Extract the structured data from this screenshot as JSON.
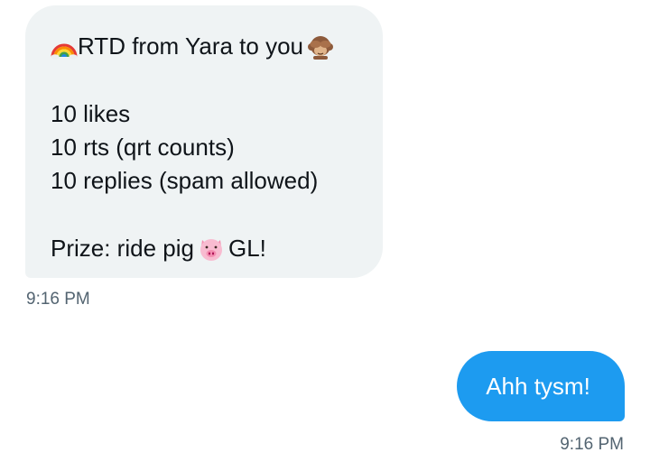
{
  "conversation": {
    "received": {
      "line1_text": "RTD from Yara to you",
      "line1_leading_icon": "rainbow-emoji",
      "line1_trailing_icon": "see-no-evil-monkey-emoji",
      "likes": "10 likes",
      "rts": "10 rts (qrt counts)",
      "replies": "10 replies (spam allowed)",
      "prize_text": "Prize: ride pig",
      "prize_icon": "pig-face-emoji",
      "prize_suffix": "GL!",
      "timestamp": "9:16 PM"
    },
    "sent": {
      "text": "Ahh tysm!",
      "timestamp": "9:16 PM"
    }
  },
  "colors": {
    "received_bubble": "#eff3f4",
    "sent_bubble": "#1d9bf0",
    "text": "#0f1419",
    "timestamp": "#536471"
  }
}
